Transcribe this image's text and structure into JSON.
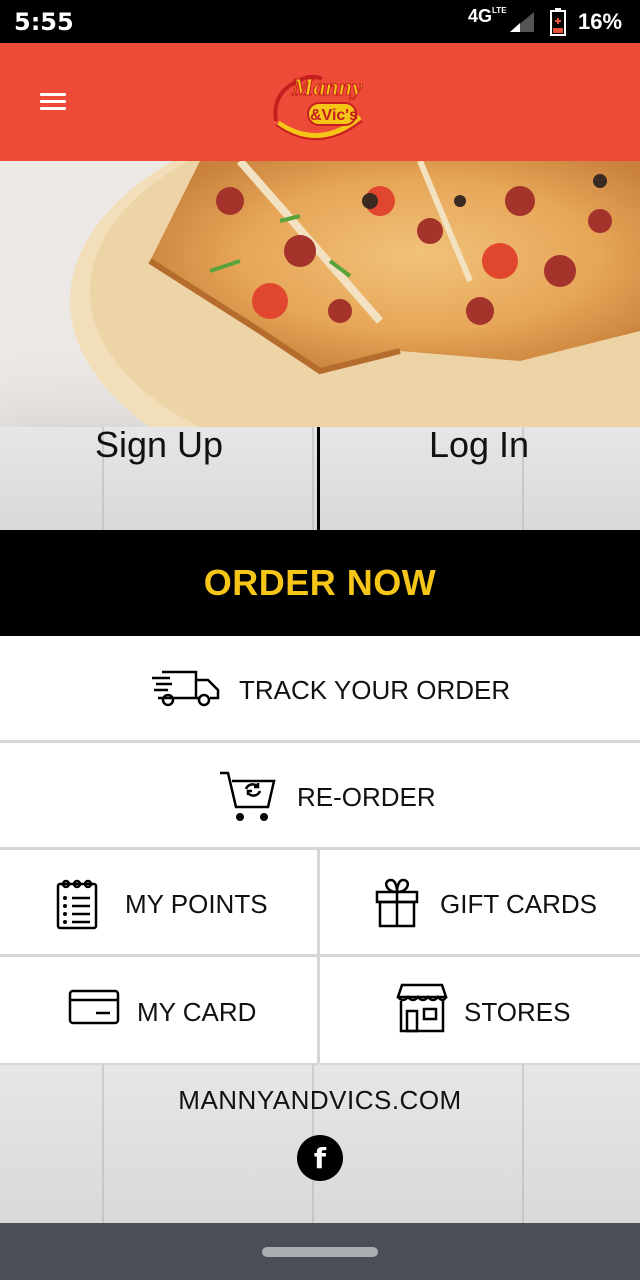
{
  "status": {
    "time": "5:55",
    "network": "4G",
    "network_sub": "LTE",
    "battery": "16%"
  },
  "header": {
    "logo_line1": "Manny",
    "logo_line2": "&Vic's"
  },
  "auth": {
    "signup": "Sign Up",
    "login": "Log In"
  },
  "order_now": "ORDER NOW",
  "menu": {
    "track": "TRACK YOUR ORDER",
    "reorder": "RE-ORDER",
    "points": "MY POINTS",
    "gift": "GIFT CARDS",
    "card": "MY CARD",
    "stores": "STORES"
  },
  "footer": {
    "site": "MANNYANDVICS.COM",
    "facebook": "f"
  },
  "colors": {
    "header": "#ee4a38",
    "accent": "#f5c518"
  }
}
